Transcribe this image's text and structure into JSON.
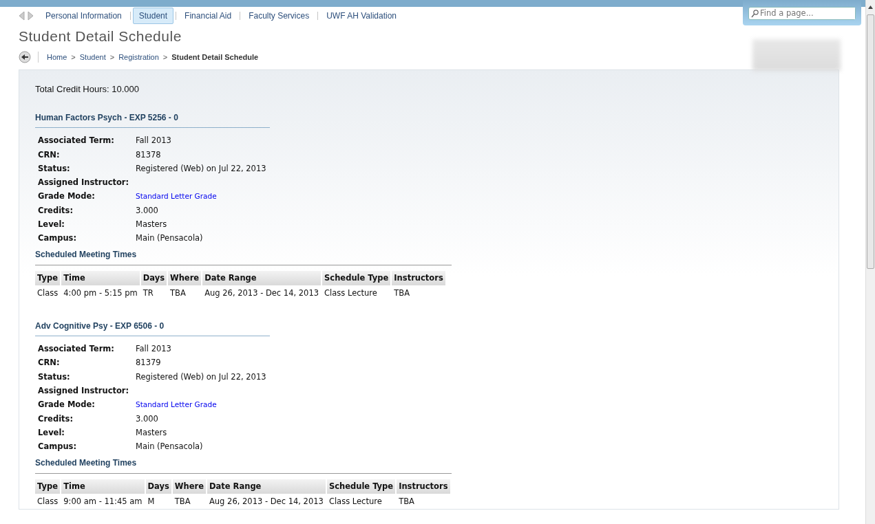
{
  "nav": {
    "items": [
      {
        "label": "Personal Information",
        "selected": false
      },
      {
        "label": "Student",
        "selected": true
      },
      {
        "label": "Financial Aid",
        "selected": false
      },
      {
        "label": "Faculty Services",
        "selected": false
      },
      {
        "label": "UWF AH Validation",
        "selected": false
      }
    ]
  },
  "search": {
    "placeholder": "Find a page..."
  },
  "page_title": "Student Detail Schedule",
  "breadcrumb": {
    "separator": ">",
    "items": [
      {
        "label": "Home",
        "current": false
      },
      {
        "label": "Student",
        "current": false
      },
      {
        "label": "Registration",
        "current": false
      },
      {
        "label": "Student Detail Schedule",
        "current": true
      }
    ]
  },
  "total_credit_hours": "Total Credit Hours: 10.000",
  "courses": [
    {
      "title": "Human Factors Psych - EXP 5256 - 0",
      "details": [
        {
          "label": "Associated Term:",
          "value": "Fall 2013"
        },
        {
          "label": "CRN:",
          "value": "81378"
        },
        {
          "label": "Status:",
          "value": "Registered (Web) on Jul 22, 2013"
        },
        {
          "label": "Assigned Instructor:"
        },
        {
          "label": "Grade Mode:",
          "value": "Standard Letter Grade",
          "kind": "link"
        },
        {
          "label": "Credits:",
          "value": "3.000"
        },
        {
          "label": "Level:",
          "value": "Masters"
        },
        {
          "label": "Campus:",
          "value": "Main (Pensacola)"
        }
      ],
      "meetings_title": "Scheduled Meeting Times",
      "columns": [
        "Type",
        "Time",
        "Days",
        "Where",
        "Date Range",
        "Schedule Type",
        "Instructors"
      ],
      "rows": [
        [
          "Class",
          "4:00 pm - 5:15 pm",
          "TR",
          "TBA",
          "Aug 26, 2013 - Dec 14, 2013",
          "Class Lecture",
          "TBA"
        ]
      ]
    },
    {
      "title": "Adv Cognitive Psy - EXP 6506 - 0",
      "details": [
        {
          "label": "Associated Term:",
          "value": "Fall 2013"
        },
        {
          "label": "CRN:",
          "value": "81379"
        },
        {
          "label": "Status:",
          "value": "Registered (Web) on Jul 22, 2013"
        },
        {
          "label": "Assigned Instructor:"
        },
        {
          "label": "Grade Mode:",
          "value": "Standard Letter Grade",
          "kind": "link"
        },
        {
          "label": "Credits:",
          "value": "3.000"
        },
        {
          "label": "Level:",
          "value": "Masters"
        },
        {
          "label": "Campus:",
          "value": "Main (Pensacola)"
        }
      ],
      "meetings_title": "Scheduled Meeting Times",
      "columns": [
        "Type",
        "Time",
        "Days",
        "Where",
        "Date Range",
        "Schedule Type",
        "Instructors"
      ],
      "rows": [
        [
          "Class",
          "9:00 am - 11:45 am",
          "M",
          "TBA",
          "Aug 26, 2013 - Dec 14, 2013",
          "Class Lecture",
          "TBA"
        ]
      ]
    }
  ]
}
